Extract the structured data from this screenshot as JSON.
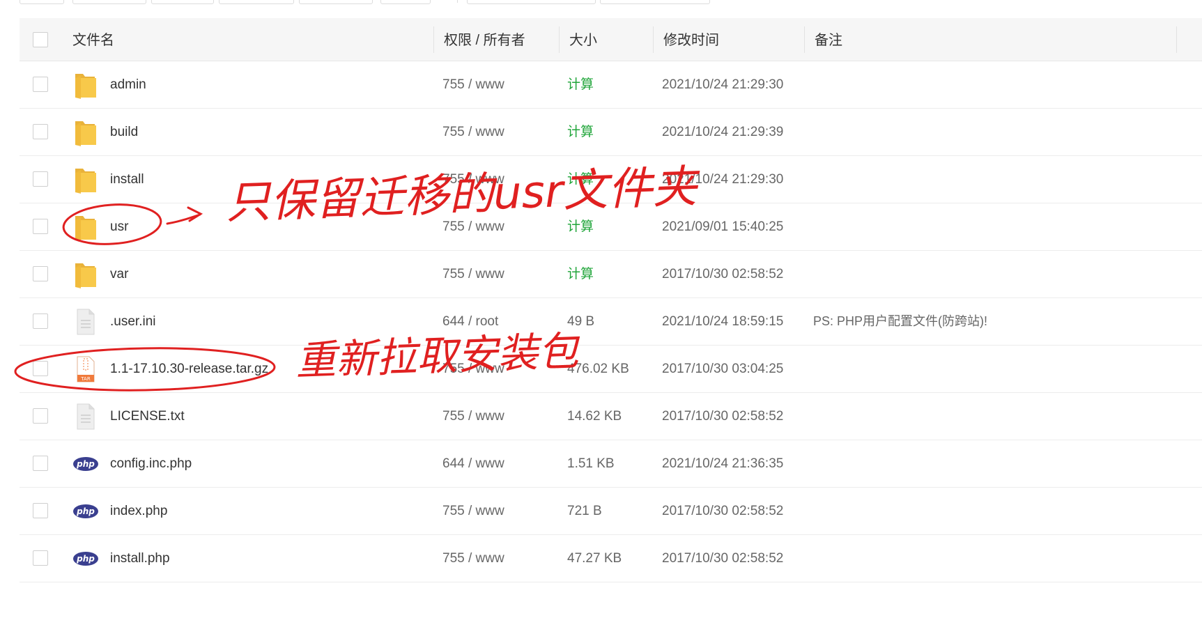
{
  "header": {
    "name": "文件名",
    "perm": "权限 / 所有者",
    "size": "大小",
    "time": "修改时间",
    "note": "备注"
  },
  "rows": [
    {
      "name": "admin",
      "type": "folder",
      "perm": "755 / www",
      "size": "计算",
      "time": "2021/10/24 21:29:30",
      "note": ""
    },
    {
      "name": "build",
      "type": "folder",
      "perm": "755 / www",
      "size": "计算",
      "time": "2021/10/24 21:29:39",
      "note": ""
    },
    {
      "name": "install",
      "type": "folder",
      "perm": "755 / www",
      "size": "计算",
      "time": "2021/10/24 21:29:30",
      "note": ""
    },
    {
      "name": "usr",
      "type": "folder",
      "perm": "755 / www",
      "size": "计算",
      "time": "2021/09/01 15:40:25",
      "note": ""
    },
    {
      "name": "var",
      "type": "folder",
      "perm": "755 / www",
      "size": "计算",
      "time": "2017/10/30 02:58:52",
      "note": ""
    },
    {
      "name": ".user.ini",
      "type": "file",
      "perm": "644 / root",
      "size": "49 B",
      "time": "2021/10/24 18:59:15",
      "note": "PS: PHP用户配置文件(防跨站)!"
    },
    {
      "name": "1.1-17.10.30-release.tar.gz",
      "type": "tar",
      "perm": "755 / www",
      "size": "476.02 KB",
      "time": "2017/10/30 03:04:25",
      "note": ""
    },
    {
      "name": "LICENSE.txt",
      "type": "file",
      "perm": "755 / www",
      "size": "14.62 KB",
      "time": "2017/10/30 02:58:52",
      "note": ""
    },
    {
      "name": "config.inc.php",
      "type": "php",
      "perm": "644 / www",
      "size": "1.51 KB",
      "time": "2021/10/24 21:36:35",
      "note": ""
    },
    {
      "name": "index.php",
      "type": "php",
      "perm": "755 / www",
      "size": "721 B",
      "time": "2017/10/30 02:58:52",
      "note": ""
    },
    {
      "name": "install.php",
      "type": "php",
      "perm": "755 / www",
      "size": "47.27 KB",
      "time": "2017/10/30 02:58:52",
      "note": ""
    }
  ],
  "icons": {
    "php_badge": "php",
    "tar_badge": "TAR"
  },
  "annotations": {
    "keep_usr": "只保留迁移的usr文件夹",
    "redownload": "重新拉取安装包",
    "color": "#e02020"
  },
  "colors": {
    "calc": "#20a53a",
    "folder": "#f8c94a",
    "php": "#3a3f8f",
    "tar": "#f07a3b"
  }
}
